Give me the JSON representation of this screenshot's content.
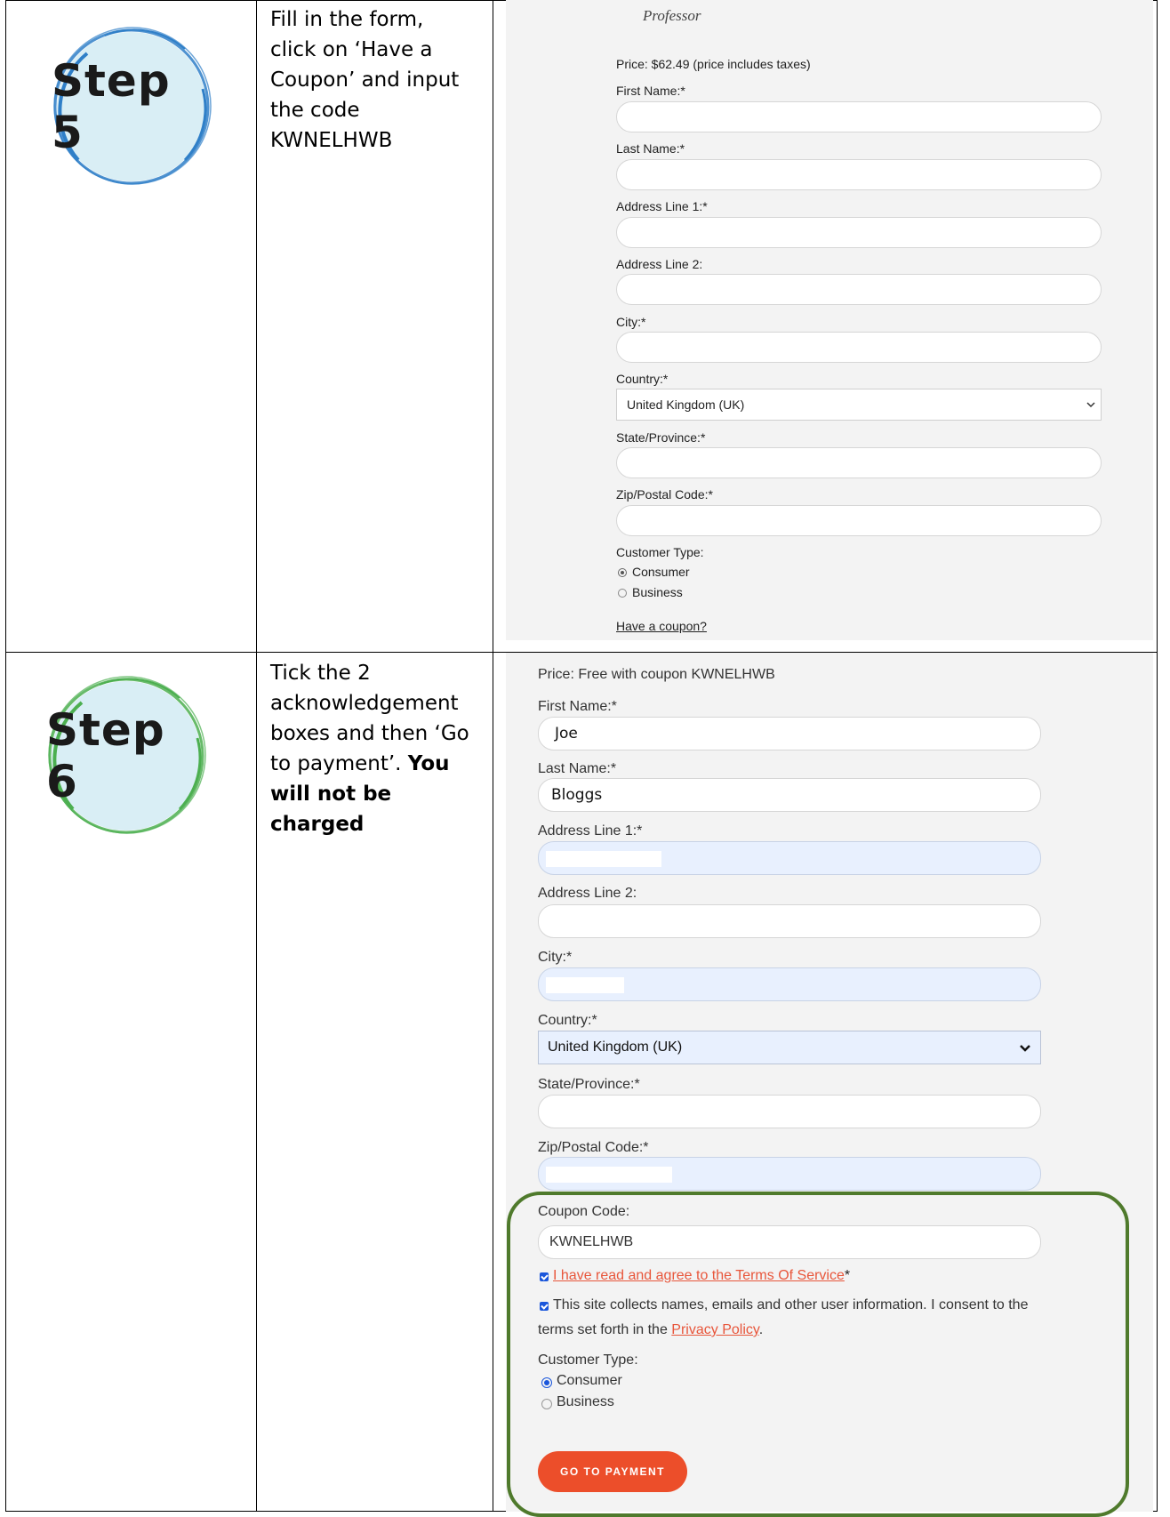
{
  "step5": {
    "badge": "Step 5",
    "instructions": [
      "Fill in the form,",
      "click on ‘Have a",
      "Coupon’ and input",
      "the code",
      "KWNELHWB"
    ],
    "form": {
      "header": "Professor",
      "price": "Price: $62.49 (price includes taxes)",
      "first_name_label": "First Name:*",
      "last_name_label": "Last Name:*",
      "address1_label": "Address Line 1:*",
      "address2_label": "Address Line 2:",
      "city_label": "City:*",
      "country_label": "Country:*",
      "country_value": "United Kingdom (UK)",
      "state_label": "State/Province:*",
      "zip_label": "Zip/Postal Code:*",
      "customer_type_label": "Customer Type:",
      "consumer": "Consumer",
      "business": "Business",
      "coupon_link": "Have a coupon?"
    }
  },
  "step6": {
    "badge": "Step 6",
    "instructions": [
      "Tick the 2",
      "acknowledgement",
      "boxes and then ‘Go",
      "to payment’."
    ],
    "instructions_bold_a": "You",
    "instructions_bold_b": "will not be charged",
    "form": {
      "price": "Price: Free with coupon KWNELHWB",
      "first_name_label": "First Name:*",
      "first_name_value": "Joe",
      "last_name_label": "Last Name:*",
      "last_name_value": "Bloggs",
      "address1_label": "Address Line 1:*",
      "address2_label": "Address Line 2:",
      "city_label": "City:*",
      "country_label": "Country:*",
      "country_value": "United Kingdom (UK)",
      "state_label": "State/Province:*",
      "zip_label": "Zip/Postal Code:*",
      "coupon_label": "Coupon Code:",
      "coupon_value": "KWNELHWB",
      "tos_link": "I have read and agree to the Terms Of Service",
      "tos_star": "*",
      "privacy_text_1": "This site collects names, emails and other user information. I consent to the",
      "privacy_text_2": "terms set forth in the",
      "privacy_link": "Privacy Policy",
      "privacy_end": ".",
      "customer_type_label": "Customer Type:",
      "consumer": "Consumer",
      "business": "Business",
      "pay_button": "GO TO PAYMENT"
    }
  },
  "colors": {
    "step5_ring": "#2f7fc8",
    "step6_ring": "#4caf50",
    "circle_fill": "#d9eef5",
    "accent": "#ec4e2a",
    "highlight_border": "#4f7a2c",
    "autofill": "#e8f0fe"
  }
}
